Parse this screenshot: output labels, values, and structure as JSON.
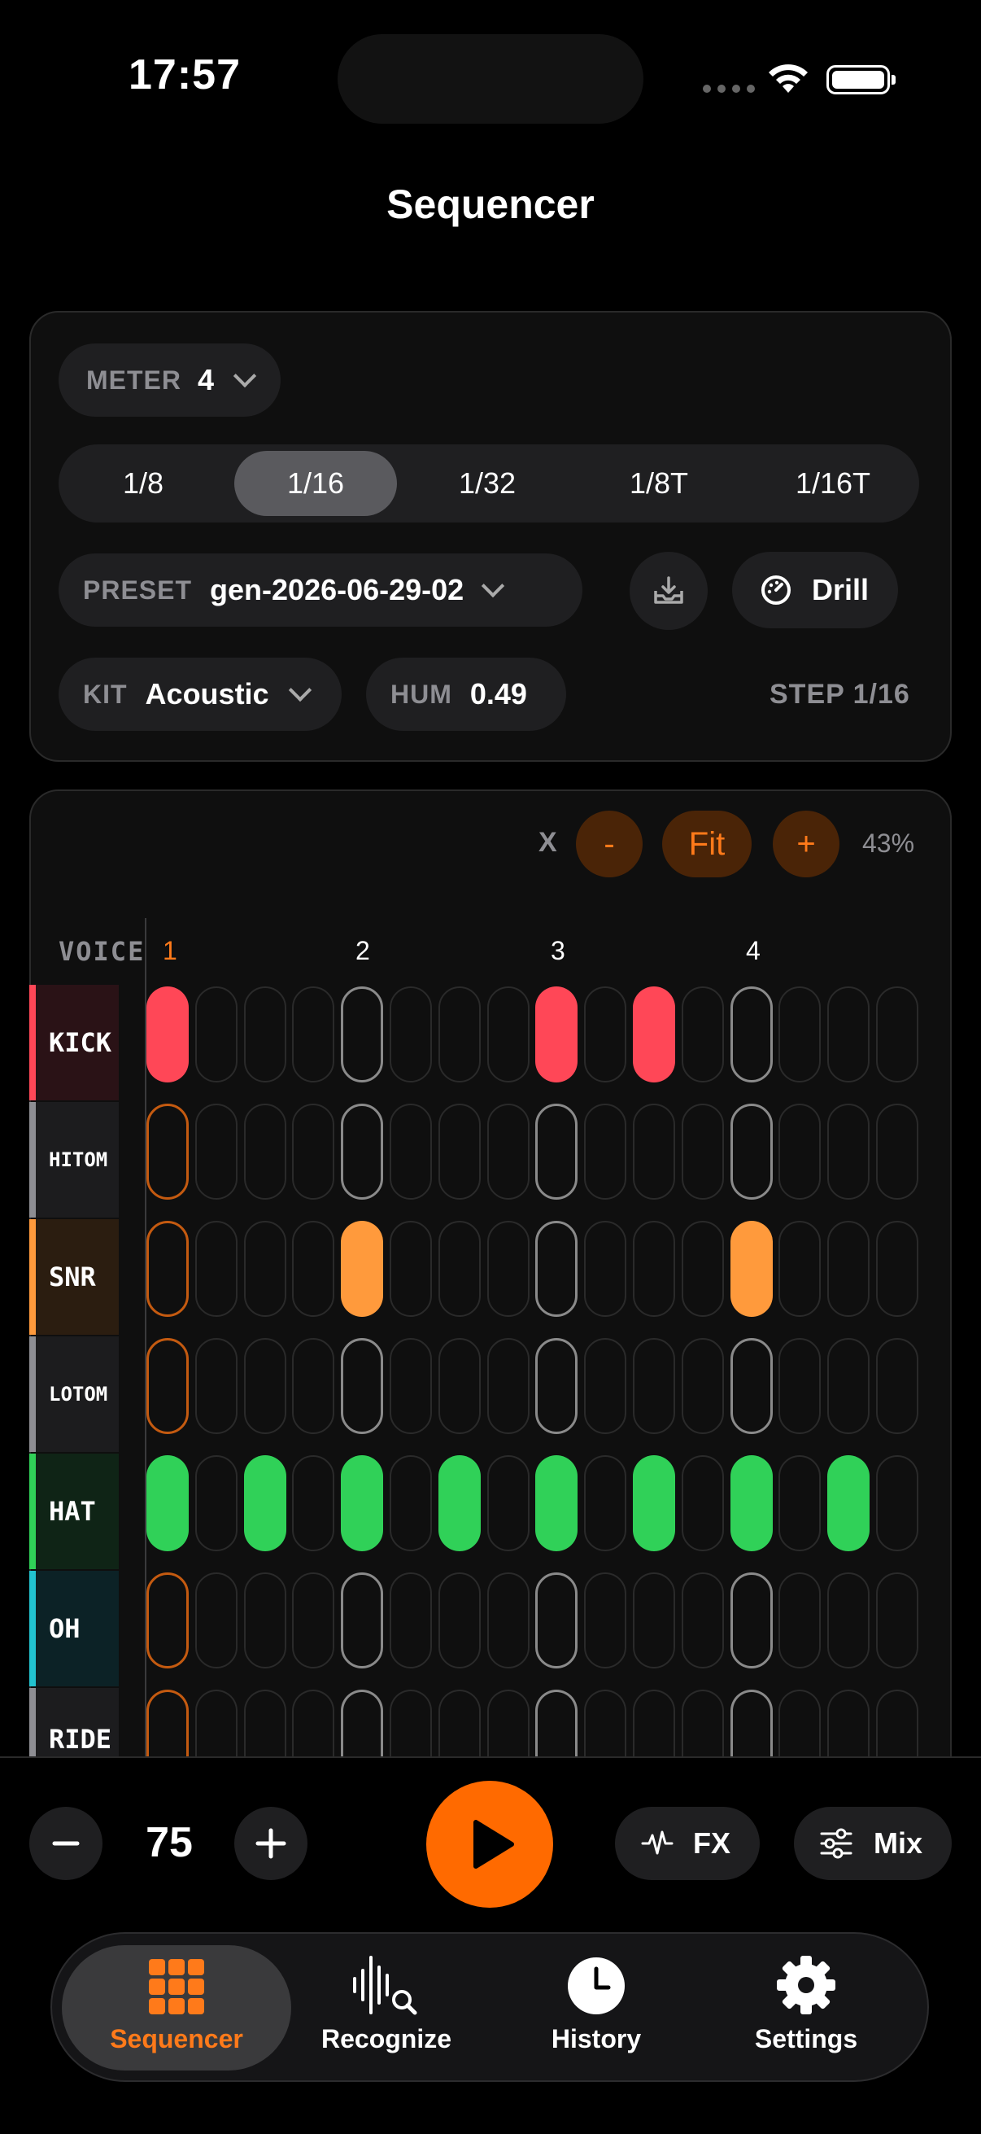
{
  "status": {
    "time": "17:57"
  },
  "header": {
    "title": "Sequencer"
  },
  "controls": {
    "meter": {
      "label": "METER",
      "value": "4"
    },
    "subdivisions": [
      "1/8",
      "1/16",
      "1/32",
      "1/8T",
      "1/16T"
    ],
    "selected_subdivision": "1/16",
    "preset": {
      "label": "PRESET",
      "value": "gen-2026-06-29-02"
    },
    "drill_label": "Drill",
    "kit": {
      "label": "KIT",
      "value": "Acoustic"
    },
    "hum": {
      "label": "HUM",
      "value": "0.49"
    },
    "step_info": "STEP 1/16"
  },
  "zoom": {
    "x_label": "X",
    "minus": "-",
    "fit": "Fit",
    "plus": "+",
    "percent": "43%"
  },
  "grid": {
    "voice_header": "VOICE",
    "beats": [
      "1",
      "2",
      "3",
      "4"
    ],
    "steps_per_row": 16,
    "voices": [
      {
        "name": "KICK",
        "color": "#ff4757",
        "bg": "#2a1216",
        "on": [
          0,
          8,
          10
        ]
      },
      {
        "name": "HITOM",
        "color": "#8e8e93",
        "bg": "#1c1c1e",
        "on": []
      },
      {
        "name": "SNR",
        "color": "#ff9a3c",
        "bg": "#2b1d10",
        "on": [
          4,
          12
        ]
      },
      {
        "name": "LOTOM",
        "color": "#8e8e93",
        "bg": "#1c1c1e",
        "on": []
      },
      {
        "name": "HAT",
        "color": "#30d158",
        "bg": "#0f2416",
        "on": [
          0,
          2,
          4,
          6,
          8,
          10,
          12,
          14
        ]
      },
      {
        "name": "OH",
        "color": "#22c3d0",
        "bg": "#0c2226",
        "on": []
      },
      {
        "name": "RIDE",
        "color": "#8e8e93",
        "bg": "#1c1c1e",
        "on": []
      }
    ]
  },
  "transport": {
    "bpm": "75",
    "fx_label": "FX",
    "mix_label": "Mix"
  },
  "tabs": [
    {
      "label": "Sequencer",
      "icon": "grid-icon",
      "active": true
    },
    {
      "label": "Recognize",
      "icon": "waveform-search-icon",
      "active": false
    },
    {
      "label": "History",
      "icon": "clock-icon",
      "active": false
    },
    {
      "label": "Settings",
      "icon": "gear-icon",
      "active": false
    }
  ],
  "colors": {
    "accent": "#ff6a00",
    "background": "#000000"
  }
}
